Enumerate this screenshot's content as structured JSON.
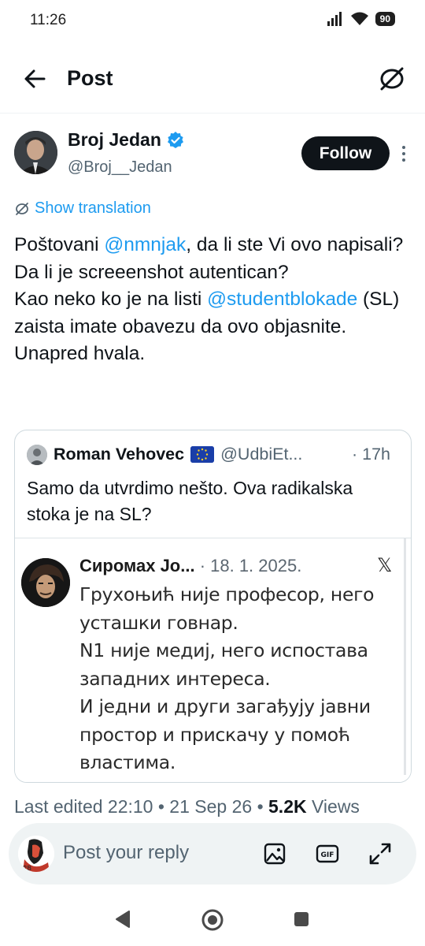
{
  "status_bar": {
    "time": "11:26",
    "battery": "90"
  },
  "header": {
    "title": "Post"
  },
  "author": {
    "name": "Broj Jedan",
    "handle": "@Broj__Jedan"
  },
  "follow_label": "Follow",
  "show_translation": "Show translation",
  "post": {
    "p1": "Poštovani ",
    "m1": "@nmnjak",
    "p2": ", da li ste Vi ovo napisali? Da li je screeenshot autentican?",
    "p3": "Kao neko ko je na listi ",
    "m2": "@studentblokade",
    "p4": " (SL) zaista imate obavezu da ovo objasnite.",
    "p5": "Unapred hvala."
  },
  "quote": {
    "name": "Roman Vehovec",
    "handle": "@UdbiEt...",
    "time": "· 17h",
    "text": "Samo da utvrdimo nešto. Ova radikalska stoka je na SL?",
    "screenshot": {
      "name": "Сиромах Јо...",
      "date": " · 18. 1. 2025.",
      "x_logo": "𝕏",
      "lines": [
        "Грухоњић није професор, него",
        "усташки говнар.",
        "N1 није медиј, него испостава",
        "западних интереса.",
        "И једни и други загађују јавни",
        "простор и прискачу у помоћ",
        "властима."
      ]
    }
  },
  "meta": {
    "edited": "Last edited 22:10 • 21 Sep 26 • ",
    "views_count": "5.2K",
    "views_label": " Views"
  },
  "reply": {
    "placeholder": "Post your reply"
  },
  "colors": {
    "accent": "#1d9bf0",
    "text": "#0f1419",
    "muted": "#536471"
  }
}
